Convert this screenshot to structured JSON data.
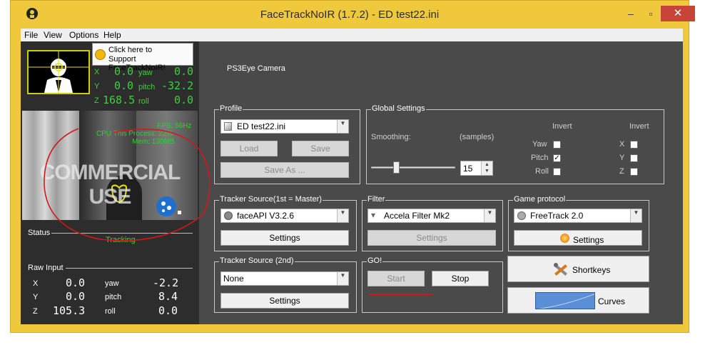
{
  "window": {
    "title": "FaceTrackNoIR (1.7.2) - ED test22.ini",
    "minimize": "–",
    "maximize": "▫",
    "close": "✕"
  },
  "menu": [
    "File",
    "View",
    "Options",
    "Help"
  ],
  "support": {
    "line1": "Click here to",
    "line2": "Support FaceTrackNoIR!"
  },
  "pose": {
    "labels": {
      "x": "X",
      "y": "Y",
      "z": "Z",
      "yaw": "yaw",
      "pitch": "pitch",
      "roll": "roll"
    },
    "values": {
      "x": "0.0",
      "y": "0.0",
      "z": "168.5",
      "yaw": "0.0",
      "pitch": "-32.2",
      "roll": "0.0"
    }
  },
  "video": {
    "fps": "FPS: 56Hz",
    "cpu": "CPU This Process: 22%",
    "mem": "Mem: 130MB",
    "watermark": "COMMERCIAL USE"
  },
  "status": {
    "label": "Status",
    "value": "Tracking"
  },
  "raw_input": {
    "label": "Raw Input",
    "labels": {
      "x": "X",
      "y": "Y",
      "z": "Z",
      "yaw": "yaw",
      "pitch": "pitch",
      "roll": "roll"
    },
    "values": {
      "x": "0.0",
      "y": "0.0",
      "z": "105.3",
      "yaw": "-2.2",
      "pitch": "8.4",
      "roll": "0.0"
    }
  },
  "camera_name": "PS3Eye Camera",
  "profile": {
    "label": "Profile",
    "selected": "ED test22.ini",
    "load": "Load",
    "save": "Save",
    "save_as": "Save As ..."
  },
  "global_settings": {
    "label": "Global Settings",
    "smoothing": "Smoothing:",
    "samples": "(samples)",
    "smoothing_value": "15",
    "invert": "Invert",
    "axes": [
      {
        "name": "Yaw",
        "checked": false
      },
      {
        "name": "Pitch",
        "checked": true
      },
      {
        "name": "Roll",
        "checked": false
      },
      {
        "name": "X",
        "checked": false
      },
      {
        "name": "Y",
        "checked": false
      },
      {
        "name": "Z",
        "checked": false
      }
    ],
    "checkmark": "✓"
  },
  "tracker1": {
    "label": "Tracker Source(1st = Master)",
    "selected": "faceAPI V3.2.6",
    "settings": "Settings"
  },
  "filter": {
    "label": "Filter",
    "selected": "Accela Filter Mk2",
    "settings": "Settings"
  },
  "game_protocol": {
    "label": "Game protocol",
    "selected": "FreeTrack 2.0",
    "settings": "Settings"
  },
  "tracker2": {
    "label": "Tracker Source (2nd)",
    "selected": "None",
    "settings": "Settings"
  },
  "go": {
    "label": "GO!",
    "start": "Start",
    "stop": "Stop"
  },
  "shortkeys": "Shortkeys",
  "curves": "Curves"
}
